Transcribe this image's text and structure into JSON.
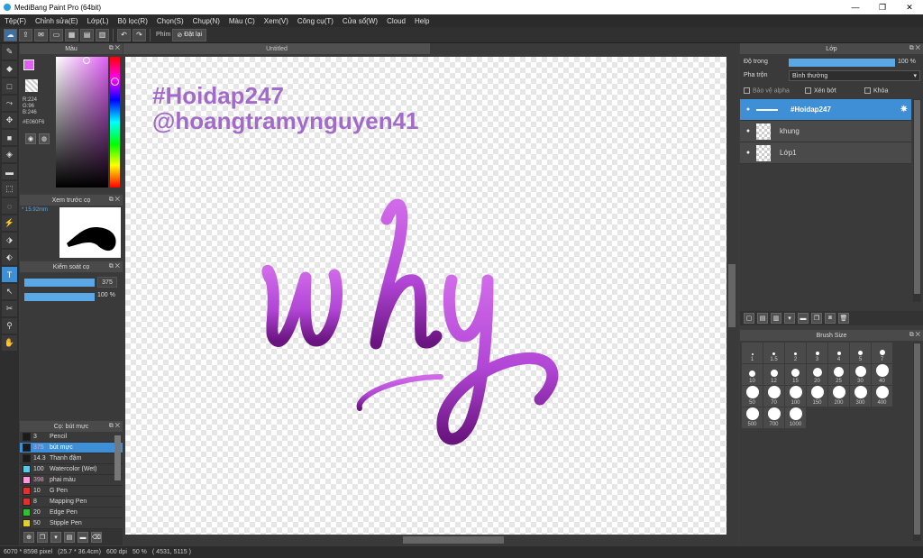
{
  "window": {
    "title": "MediBang Paint Pro (64bit)",
    "controls": [
      "—",
      "❐",
      "✕"
    ]
  },
  "menu": [
    "Tệp(F)",
    "Chỉnh sửa(E)",
    "Lớp(L)",
    "Bộ lọc(R)",
    "Chọn(S)",
    "Chụp(N)",
    "Màu (C)",
    "Xem(V)",
    "Công cụ(T)",
    "Cửa sổ(W)",
    "Cloud",
    "Help"
  ],
  "toolbar": {
    "key_label": "Phím",
    "reset_label": "Đặt lại"
  },
  "color_panel": {
    "title": "Màu",
    "r": "R:224",
    "g": "G:96",
    "b": "B:246",
    "hex": "#E060F6",
    "primary": "#e060f6"
  },
  "preview_panel": {
    "title": "Xem trước cọ",
    "size": "15.92mm"
  },
  "control_panel": {
    "title": "Kiểm soát cọ",
    "size_value": "375",
    "opacity_value": "100 %"
  },
  "brush_panel": {
    "title": "Cọ: bút mực",
    "items": [
      {
        "size": "3",
        "name": "Pencil",
        "color": "#1a1a1a"
      },
      {
        "size": "375",
        "name": "bút mực",
        "color": "#1a1a1a",
        "selected": true
      },
      {
        "size": "14.3",
        "name": "Thanh đậm",
        "color": "#1a1a1a"
      },
      {
        "size": "100",
        "name": "Watercolor (Wet)",
        "color": "#5bc8e8"
      },
      {
        "size": "398",
        "name": "phai màu",
        "color": "#ff9ad8"
      },
      {
        "size": "10",
        "name": "G Pen",
        "color": "#e03030"
      },
      {
        "size": "8",
        "name": "Mapping Pen",
        "color": "#e03030"
      },
      {
        "size": "20",
        "name": "Edge Pen",
        "color": "#30c030"
      },
      {
        "size": "50",
        "name": "Stipple Pen",
        "color": "#e0d030"
      }
    ]
  },
  "canvas": {
    "tab_title": "Untitled",
    "line1": "#Hoidap247",
    "line2": "@hoangtramynguyen41",
    "lettering": "why"
  },
  "layer_panel": {
    "title": "Lớp",
    "opacity_label": "Độ trong",
    "opacity_value": "100 %",
    "opacity_level": 1.0,
    "blend_label": "Pha trộn",
    "blend_value": "Bình thường",
    "opt_alpha": "Bảo vệ alpha",
    "opt_clip": "Xén bớt",
    "opt_lock": "Khóa",
    "layers": [
      {
        "name": "#Hoidap247",
        "selected": true
      },
      {
        "name": "khung"
      },
      {
        "name": "Lớp1"
      }
    ]
  },
  "brush_size_panel": {
    "title": "Brush Size",
    "sizes": [
      "1",
      "1.5",
      "2",
      "3",
      "4",
      "5",
      "7",
      "10",
      "12",
      "15",
      "20",
      "25",
      "30",
      "40",
      "50",
      "70",
      "100",
      "150",
      "200",
      "300",
      "400",
      "500",
      "700",
      "1000"
    ]
  },
  "status": {
    "pixels": "6070 * 8598 pixel",
    "cm": "(25.7 * 36.4cm)",
    "dpi": "600 dpi",
    "zoom": "50 %",
    "coords": "( 4531, 5115 )"
  }
}
